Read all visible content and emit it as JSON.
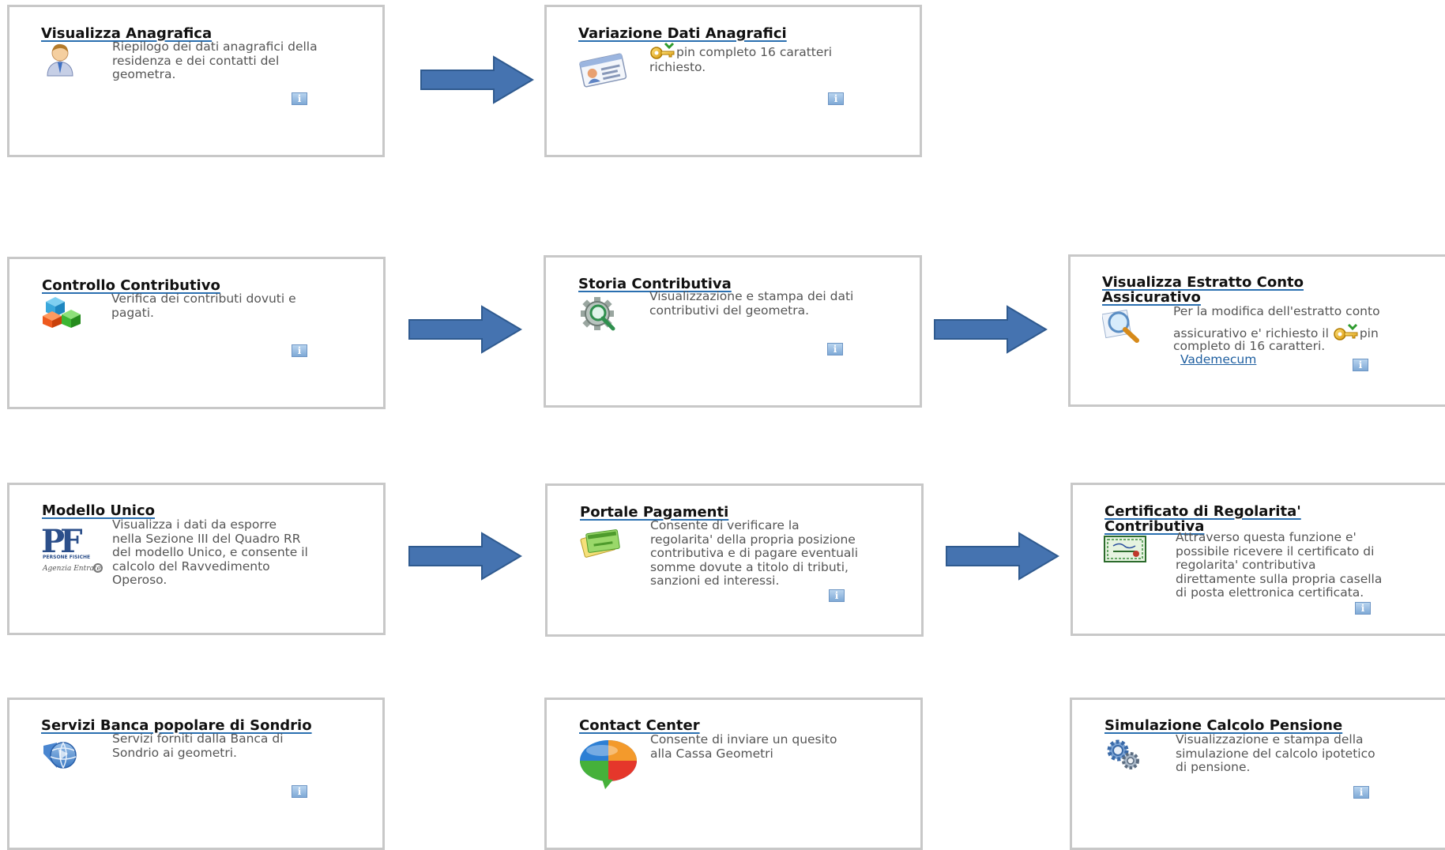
{
  "cards": [
    {
      "id": "visualizza-anagrafica",
      "title": "Visualizza Anagrafica",
      "icon": "user-icon",
      "desc": [
        "Riepilogo dei dati anagrafici della",
        "residenza e dei contatti del",
        "geometra."
      ],
      "info": "i"
    },
    {
      "id": "variazione-dati-anagrafici",
      "title": "Variazione Dati Anagrafici",
      "icon": "id-card-icon",
      "desc_l1": "pin completo 16 caratteri",
      "desc_l2": "richiesto.",
      "info": "i"
    },
    {
      "id": "controllo-contributivo",
      "title": "Controllo Contributivo",
      "icon": "cubes-icon",
      "desc": [
        "Verifica dei contributi dovuti e",
        "pagati."
      ],
      "info": "i"
    },
    {
      "id": "storia-contributiva",
      "title": "Storia Contributiva",
      "icon": "gear-magnifier-icon",
      "desc": [
        "Visualizzazione e stampa dei dati",
        "contributivi del geometra."
      ],
      "info": "i"
    },
    {
      "id": "visualizza-estratto-conto",
      "title_l1": "Visualizza Estratto Conto",
      "title_l2": "Assicurativo",
      "icon": "magnifier-icon",
      "desc_l1": "Per la modifica dell'estratto conto",
      "desc_l2": "assicurativo e' richiesto il",
      "desc_l2b": "pin",
      "desc_l3": "completo di 16 caratteri.",
      "link": "Vademecum",
      "info": "i"
    },
    {
      "id": "modello-unico",
      "title": "Modello Unico",
      "icon": "persone-fisiche-logo",
      "logo_text_1": "PERSONE FISICHE",
      "logo_text_2": "Agenzia Entrate",
      "desc": [
        "Visualizza i dati da esporre",
        "nella Sezione III del Quadro RR",
        "del modello Unico, e consente il",
        "calcolo del Ravvedimento",
        "Operoso."
      ]
    },
    {
      "id": "portale-pagamenti",
      "title": "Portale Pagamenti",
      "icon": "payment-cards-icon",
      "desc": [
        "Consente di verificare la",
        "regolarita' della propria posizione",
        "contributiva e di pagare eventuali",
        "somme dovute a titolo di tributi,",
        "sanzioni ed interessi."
      ],
      "info": "i"
    },
    {
      "id": "certificato-regolarita",
      "title_l1": "Certificato di Regolarita'",
      "title_l2": "Contributiva",
      "icon": "certificate-icon",
      "desc": [
        "Attraverso questa funzione e'",
        "possibile ricevere il certificato di",
        "regolarita' contributiva",
        "direttamente sulla propria casella",
        "di posta elettronica certificata."
      ],
      "info": "i"
    },
    {
      "id": "servizi-banca",
      "title": "Servizi Banca popolare di Sondrio",
      "icon": "globe-icon",
      "desc": [
        "Servizi forniti dalla Banca di",
        "Sondrio ai geometri."
      ],
      "info": "i"
    },
    {
      "id": "contact-center",
      "title": "Contact Center",
      "icon": "chat-bubble-icon",
      "desc": [
        "Consente di inviare un quesito",
        "alla Cassa Geometri"
      ]
    },
    {
      "id": "simulazione-pensione",
      "title": "Simulazione Calcolo Pensione",
      "icon": "gears-icon",
      "desc": [
        "Visualizzazione e stampa della",
        "simulazione del calcolo ipotetico",
        "di pensione."
      ],
      "info": "i"
    }
  ],
  "colors": {
    "arrow": "#4573b0",
    "arrow_border": "#2f5a8f",
    "title_underline": "#2a6fb0",
    "card_border": "#c8c8c8",
    "link": "#1f5fa0"
  }
}
